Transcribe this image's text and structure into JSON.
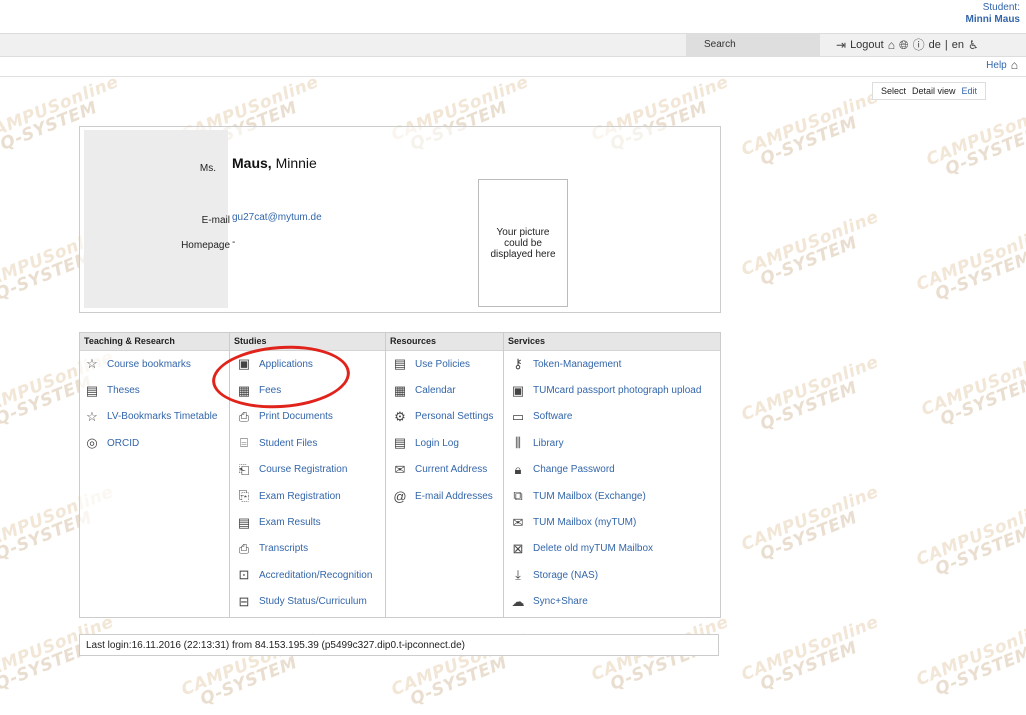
{
  "user": {
    "role_label": "Student:",
    "name": "Minni Maus"
  },
  "topbar": {
    "search_label": "Search",
    "logout_label": "Logout",
    "lang_de": "de",
    "lang_sep": "|",
    "lang_en": "en",
    "icons": [
      "logout-icon",
      "home-icon",
      "globe-icon",
      "info-icon",
      "accessibility-icon"
    ]
  },
  "help": {
    "label": "Help"
  },
  "view_tabs": {
    "select": "Select",
    "detail": "Detail view",
    "edit": "Edit"
  },
  "profile": {
    "salutation": "Ms.",
    "surname": "Maus,",
    "firstname": "Minnie",
    "email_label": "E-mail",
    "email_value": "gu27cat@mytum.de",
    "homepage_label": "Homepage",
    "homepage_value": "-",
    "picture_placeholder": "Your picture could be displayed here"
  },
  "menu": {
    "teaching": {
      "header": "Teaching & Research",
      "items": [
        {
          "label": "Course bookmarks",
          "icon": "star-icon"
        },
        {
          "label": "Theses",
          "icon": "document-list-icon"
        },
        {
          "label": "LV-Bookmarks Timetable",
          "icon": "star-plus-icon"
        },
        {
          "label": "ORCID",
          "icon": "id-badge-icon"
        }
      ]
    },
    "studies": {
      "header": "Studies",
      "items": [
        {
          "label": "Applications",
          "icon": "application-form-icon"
        },
        {
          "label": "Fees",
          "icon": "calculator-icon"
        },
        {
          "label": "Print Documents",
          "icon": "printer-icon"
        },
        {
          "label": "Student Files",
          "icon": "group-folder-icon"
        },
        {
          "label": "Course Registration",
          "icon": "registration-icon"
        },
        {
          "label": "Exam Registration",
          "icon": "exam-registration-icon"
        },
        {
          "label": "Exam Results",
          "icon": "results-list-icon"
        },
        {
          "label": "Transcripts",
          "icon": "transcript-printer-icon"
        },
        {
          "label": "Accreditation/Recognition",
          "icon": "accreditation-icon"
        },
        {
          "label": "Study Status/Curriculum",
          "icon": "curriculum-icon"
        }
      ]
    },
    "resources": {
      "header": "Resources",
      "items": [
        {
          "label": "Use Policies",
          "icon": "policy-document-icon"
        },
        {
          "label": "Calendar",
          "icon": "calendar-icon"
        },
        {
          "label": "Personal Settings",
          "icon": "gear-icon"
        },
        {
          "label": "Login Log",
          "icon": "log-list-icon"
        },
        {
          "label": "Current Address",
          "icon": "envelope-icon"
        },
        {
          "label": "E-mail Addresses",
          "icon": "at-sign-icon"
        }
      ]
    },
    "services": {
      "header": "Services",
      "items": [
        {
          "label": "Token-Management",
          "icon": "key-icon"
        },
        {
          "label": "TUMcard passport photograph upload",
          "icon": "id-card-icon"
        },
        {
          "label": "Software",
          "icon": "monitor-icon"
        },
        {
          "label": "Library",
          "icon": "books-icon"
        },
        {
          "label": "Change Password",
          "icon": "lock-icon"
        },
        {
          "label": "TUM Mailbox (Exchange)",
          "icon": "exchange-mail-icon"
        },
        {
          "label": "TUM Mailbox (myTUM)",
          "icon": "mail-icon"
        },
        {
          "label": "Delete old myTUM Mailbox",
          "icon": "delete-mailbox-icon"
        },
        {
          "label": "Storage (NAS)",
          "icon": "storage-download-icon"
        },
        {
          "label": "Sync+Share",
          "icon": "cloud-upload-icon"
        }
      ]
    }
  },
  "footer": {
    "last_login": "Last login:16.11.2016 (22:13:31) from 84.153.195.39 (p5499c327.dip0.t-ipconnect.de)"
  },
  "watermark": {
    "line1": "CAMPUSonline",
    "line2": "Q-SYSTEM"
  },
  "colors": {
    "link": "#3366aa",
    "annotation_circle": "#e0241b",
    "header_bar": "#f0f0f0"
  }
}
